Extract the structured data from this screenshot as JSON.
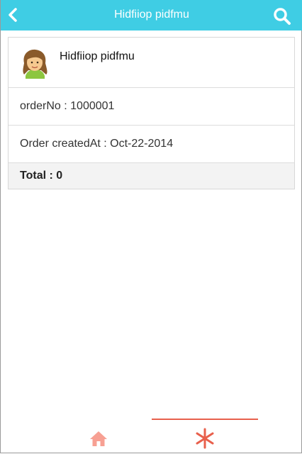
{
  "header": {
    "title": "Hidfiiop pidfmu",
    "back_icon": "chevron-left-icon",
    "search_icon": "search-icon",
    "bar_color": "#3fcde4"
  },
  "order": {
    "user_name": "Hidfiiop pidfmu",
    "avatar_icon": "girl-avatar-icon",
    "order_no": "orderNo : 1000001",
    "created_at": "Order createdAt : Oct-22-2014",
    "total": "Total : 0"
  },
  "bottom_nav": {
    "items": [
      {
        "icon": "home-icon",
        "active": false
      },
      {
        "icon": "asterisk-icon",
        "active": true
      }
    ],
    "active_color": "#e8604c",
    "inactive_color": "#f7a093"
  }
}
